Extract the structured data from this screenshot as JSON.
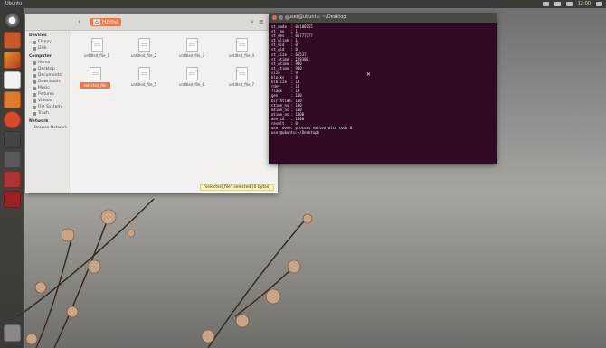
{
  "topbar": {
    "app_name": "Ubuntu",
    "clock": "12:00"
  },
  "launcher": {
    "icons": [
      "dash-icon",
      "files-icon",
      "firefox-icon",
      "office-writer-icon",
      "office-calc-icon",
      "ubuntu-software-icon",
      "system-settings-icon",
      "terminal-icon",
      "workspace-icon",
      "disk-icon",
      "trash-icon"
    ]
  },
  "file_manager": {
    "back": "‹",
    "path_home": "⌂",
    "path_current": "Home",
    "sidebar": {
      "sections": [
        {
          "header": "Devices",
          "items": [
            "Floppy",
            "Disk"
          ]
        },
        {
          "header": "Computer",
          "items": [
            "Home",
            "Desktop",
            "Documents",
            "Downloads",
            "Music",
            "Pictures",
            "Videos",
            "File System",
            "Trash"
          ]
        },
        {
          "header": "Network",
          "items": [
            "Browse Network"
          ]
        }
      ]
    },
    "files": [
      {
        "name": "untitled_file_1",
        "selected": false
      },
      {
        "name": "untitled_file_2",
        "selected": false
      },
      {
        "name": "untitled_file_3",
        "selected": false
      },
      {
        "name": "untitled_file_4",
        "selected": false
      },
      {
        "name": "selected_file",
        "selected": true
      },
      {
        "name": "untitled_file_5",
        "selected": false
      },
      {
        "name": "untitled_file_6",
        "selected": false
      },
      {
        "name": "untitled_file_7",
        "selected": false
      }
    ],
    "status": "\"selected_file\" selected (0 bytes)"
  },
  "terminal": {
    "title": "user@ubuntu: ~/Desktop",
    "lines": [
      "st_mode  : 0o100755",
      "st_ino   : 1",
      "st_dev   : 0o777777",
      "st_nlink : 1",
      "st_uid   : 0",
      "st_gid   : 0",
      "st_size  : 65537",
      "st_atime : 128300",
      "st_mtime : 900",
      "st_ctime : 900",
      "size     : 9",
      "blocks   : 8",
      "blksize  : 10",
      "rdev     : 10",
      "flags    : 10",
      "gen      : 100",
      "birthtime: 100",
      "ctime_ns : 100",
      "mtime_ns : 100",
      "atime_ns : 1000",
      "dev_id   : 1000",
      "result   : 0",
      "user done: process exited with code 0",
      "user@ubuntu:~/Desktop$ "
    ]
  },
  "colors": {
    "accent": "#f07746",
    "terminal_bg": "#300a24",
    "panel": "#3c3b37"
  }
}
